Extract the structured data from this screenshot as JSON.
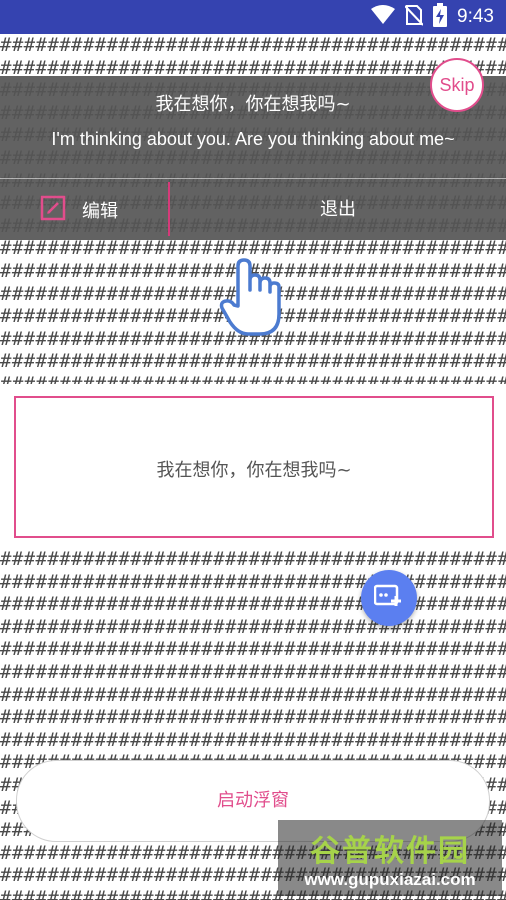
{
  "status_bar": {
    "time": "9:43"
  },
  "background_pattern_char": "#",
  "guide_overlay": {
    "chinese_text": "我在想你，你在想我吗~",
    "english_text": "I'm thinking about you. Are you thinking about me~",
    "skip_label": "Skip",
    "edit_label": "编辑",
    "exit_label": "退出"
  },
  "float_preview": {
    "text": "我在想你，你在想我吗~"
  },
  "start_button": {
    "label": "启动浮窗"
  },
  "watermark": {
    "title": "谷普软件园",
    "url": "www.gupuxiazai.com"
  },
  "colors": {
    "status_bar": "#3543b0",
    "accent_pink": "#e14d8c",
    "fab_blue": "#5b7ff0"
  },
  "icons": [
    "wifi-icon",
    "no-sim-icon",
    "battery-charging-icon",
    "edit-checkbox-icon",
    "pointing-hand-icon",
    "add-float-window-icon"
  ]
}
